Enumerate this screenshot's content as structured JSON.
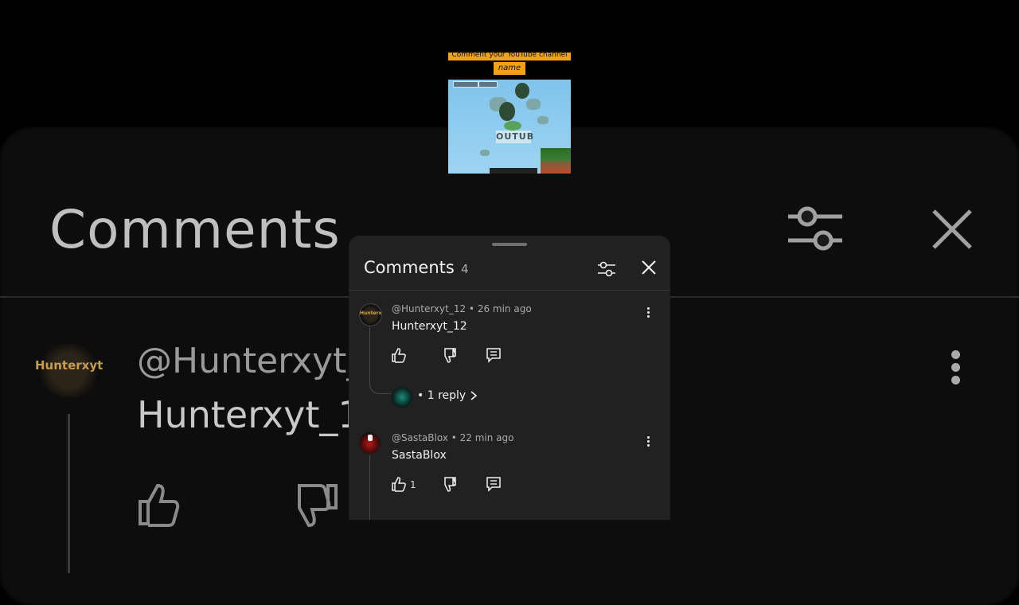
{
  "background": {
    "title": "Comments",
    "user": "@Hunterxyt_1",
    "text": "Hunterxyt_1",
    "avatar_text": "Hunterxyt"
  },
  "video": {
    "caption_line": "Comment your YouTube channel",
    "caption_name": "name",
    "sign_text": "OUTUB"
  },
  "panel": {
    "title": "Comments",
    "count": "4",
    "filter_icon": "sliders-icon",
    "close_icon": "close-icon"
  },
  "comments": [
    {
      "handle": "@Hunterxyt_12",
      "time": "26 min ago",
      "meta": "@Hunterxyt_12 • 26 min ago",
      "text": "Hunterxyt_12",
      "avatar_text": "Hunterxyt",
      "likes": "",
      "replies": "• 1 reply"
    },
    {
      "handle": "@SastaBlox",
      "time": "22 min ago",
      "meta": "@SastaBlox • 22 min ago",
      "text": "SastaBlox",
      "likes": "1"
    }
  ]
}
